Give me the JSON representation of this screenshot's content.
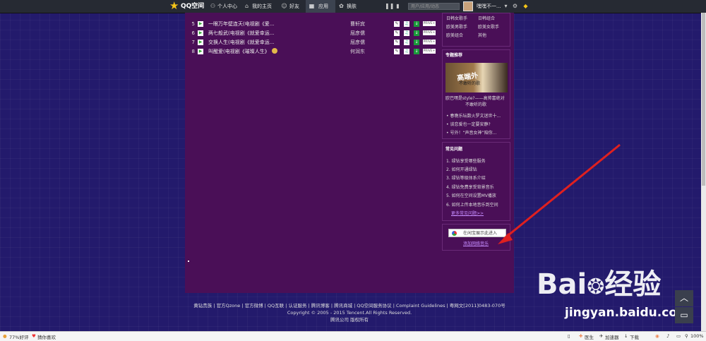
{
  "topbar": {
    "logo": "QQ空间",
    "personal_center": "个人中心",
    "my_home": "我的主页",
    "friends": "好友",
    "apps": "应用",
    "skin": "换肤",
    "search_placeholder": "用户/应用/动态",
    "username": "嘿嘿不一..."
  },
  "songs": [
    {
      "num": "5",
      "title": "一眼万年壁连天(电视剧《爱...",
      "singer": "曹轩宾"
    },
    {
      "num": "6",
      "title": "两七般武(电视剧《就爱幸运...",
      "singer": "屈彦儒"
    },
    {
      "num": "7",
      "title": "交换人生(电视剧《就爱幸运...",
      "singer": "屈彦儒"
    },
    {
      "num": "8",
      "title": "叫醒爱(电视剧《璀璨人生》",
      "singer": "何润东"
    }
  ],
  "song_buttons": {
    "b4": "PRIVE+"
  },
  "sidebar": {
    "genres": [
      "日韩女歌手",
      "日韩组合",
      "欧美男歌手",
      "欧美女歌手",
      "欧美组合",
      "其他"
    ],
    "topic": {
      "title": "专题推荐",
      "image_text": "高端外",
      "image_sub": "不敢听的歌",
      "caption_line1": "欧巴嘿是style?——高帅富绝对",
      "caption_line2": "不敢听的歌",
      "links": [
        "春晚乐坛数火罗文迷世十...",
        "谈恋爱也一定要安静?",
        "号外！“声音女神”陪你..."
      ]
    },
    "faq": {
      "title": "常见问题",
      "items": [
        "1. 绿钻享受哪些服务",
        "2. 如何开通绿钻",
        "3. 绿钻等级体系介绍",
        "4. 绿钻免费享受背景音乐",
        "5. 如何在空间设置MV播放",
        "6. 如何上传本地音乐到空间"
      ],
      "more": "更多常见问题>>"
    },
    "install": {
      "button": "在闲宝展示此进入",
      "link": "添加网络音乐"
    }
  },
  "footer": {
    "links": "黄钻贵族 | 官方Qzone | 官方微博 | QQ互联 | 认证服务 | 腾讯博客 | 腾讯商城 | QQ空间服务协议 | Complaint Guidelines | 粤网文[2011]0483-070号",
    "copyright": "Copyright © 2005 - 2015 Tencent.All Rights Reserved.",
    "company": "腾讯公司 版权所有"
  },
  "statusbar": {
    "left1": "77%好评",
    "left2": "猜你喜欢",
    "doctor": "医生",
    "accelerator": "加速器",
    "download": "下载",
    "zoom": "100%"
  },
  "watermark": {
    "brand": "Bai",
    "brand_suffix": "经验",
    "url": "jingyan.baidu.com"
  },
  "colors": {
    "accent": "#4a0f57",
    "background": "#231a6c",
    "arrow": "#e0201f"
  }
}
